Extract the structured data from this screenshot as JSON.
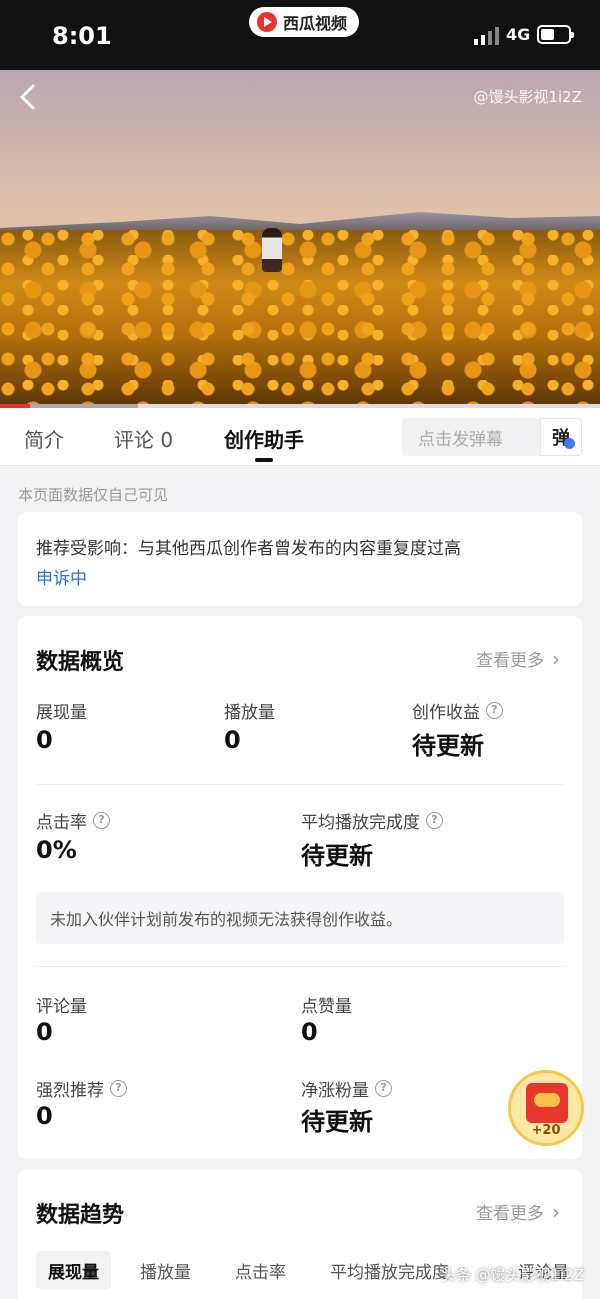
{
  "status_bar": {
    "time": "8:01",
    "app_pill": "西瓜视频",
    "network": "4G"
  },
  "video": {
    "watermark": "@馒头影视1i2Z"
  },
  "tabs": [
    {
      "label": "简介"
    },
    {
      "label": "评论 0"
    },
    {
      "label": "创作助手"
    }
  ],
  "danmu": {
    "placeholder": "点击发弹幕",
    "button": "弹"
  },
  "page_notice": "本页面数据仅自己可见",
  "recommend_card": {
    "text": "推荐受影响：与其他西瓜创作者曾发布的内容重复度过高",
    "status": "申诉中"
  },
  "overview": {
    "title": "数据概览",
    "more": "查看更多",
    "impressions": {
      "label": "展现量",
      "value": "0"
    },
    "plays": {
      "label": "播放量",
      "value": "0"
    },
    "earnings": {
      "label": "创作收益",
      "value": "待更新"
    },
    "ctr": {
      "label": "点击率",
      "value": "0%"
    },
    "completion": {
      "label": "平均播放完成度",
      "value": "待更新"
    },
    "partner_note": "未加入伙伴计划前发布的视频无法获得创作收益。",
    "comments": {
      "label": "评论量",
      "value": "0"
    },
    "likes": {
      "label": "点赞量",
      "value": "0"
    },
    "strong_rec": {
      "label": "强烈推荐",
      "value": "0"
    },
    "net_fans": {
      "label": "净涨粉量",
      "value": "待更新"
    }
  },
  "reward_badge": "+20",
  "trend": {
    "title": "数据趋势",
    "more": "查看更多",
    "tabs": [
      "展现量",
      "播放量",
      "点击率",
      "平均播放完成度",
      "评论量"
    ]
  },
  "footer_watermark": "头条 @馒头影视1i2Z"
}
